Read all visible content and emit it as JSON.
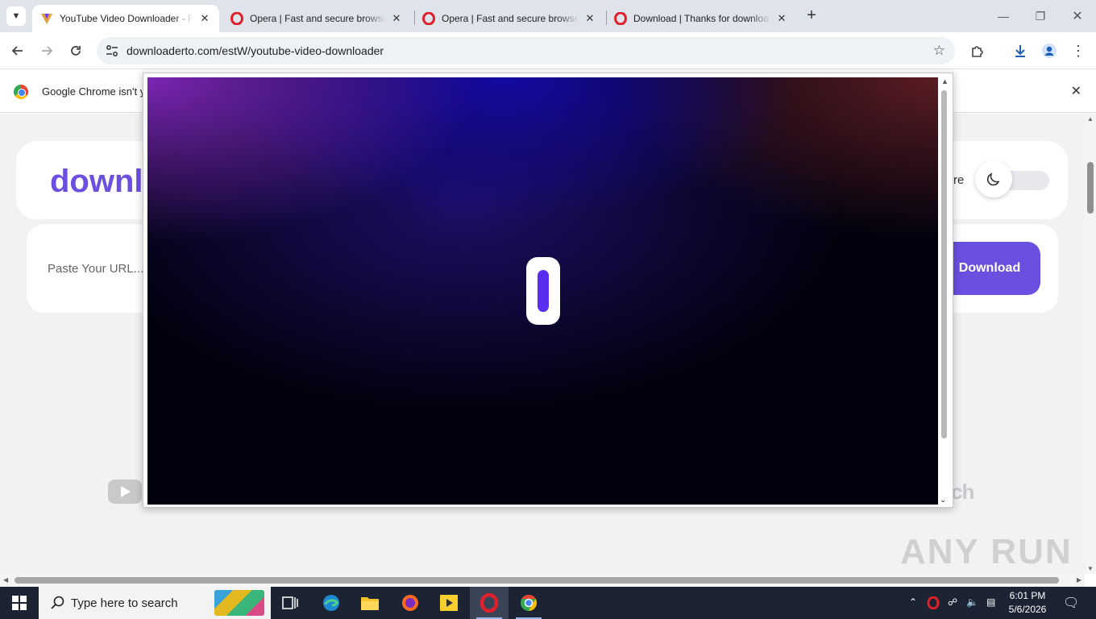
{
  "browser": {
    "tabs": [
      {
        "title": "YouTube Video Downloader - F",
        "favicon": "downloader-v-icon",
        "active": true
      },
      {
        "title": "Opera | Fast and secure browse",
        "favicon": "opera-icon",
        "active": false
      },
      {
        "title": "Opera | Fast and secure browse",
        "favicon": "opera-icon",
        "active": false
      },
      {
        "title": "Download | Thanks for downloa",
        "favicon": "opera-icon",
        "active": false
      }
    ],
    "url": "downloaderto.com/estW/youtube-video-downloader",
    "infobar_message": "Google Chrome isn't y"
  },
  "page": {
    "brand_text": "downl",
    "language_text": "re",
    "url_placeholder": "Paste Your URL...",
    "download_button": "Download",
    "platform_right_text": "ch"
  },
  "watermark": "ANY RUN",
  "taskbar": {
    "search_placeholder": "Type here to search",
    "time": "6:01 PM",
    "date": "5/6/2026"
  },
  "colors": {
    "accent": "#6b4fe0",
    "tabstrip": "#dfe3ea",
    "taskbar": "#1c2433"
  }
}
